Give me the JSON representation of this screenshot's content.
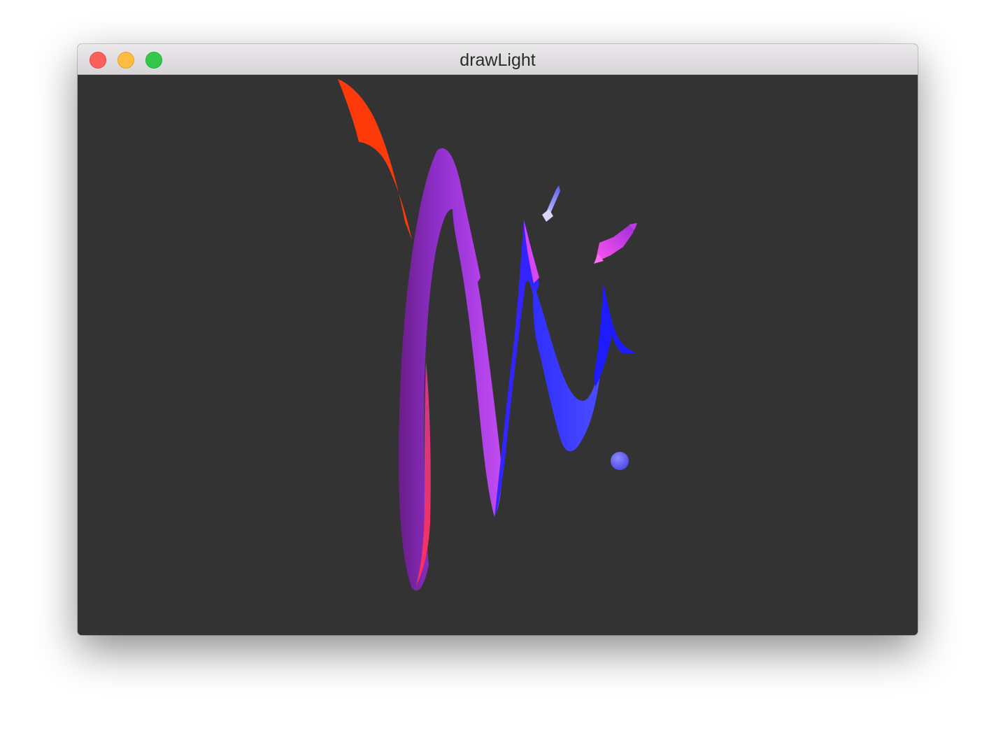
{
  "window": {
    "title": "drawLight",
    "background": "#333333"
  },
  "titlebar_buttons": [
    {
      "name": "close",
      "color": "#fc605c"
    },
    {
      "name": "minimize",
      "color": "#fdbc40"
    },
    {
      "name": "zoom",
      "color": "#34c84a"
    }
  ],
  "scene": {
    "colors": {
      "red_ribbon": "#ff3a0a",
      "purple_ribbon": "#a33fe0",
      "pink_edge": "#ff3060",
      "blue_ribbon": "#2e22ff",
      "light_marker": "#6a66ff",
      "magenta_arrow": "#d84cf0"
    }
  }
}
